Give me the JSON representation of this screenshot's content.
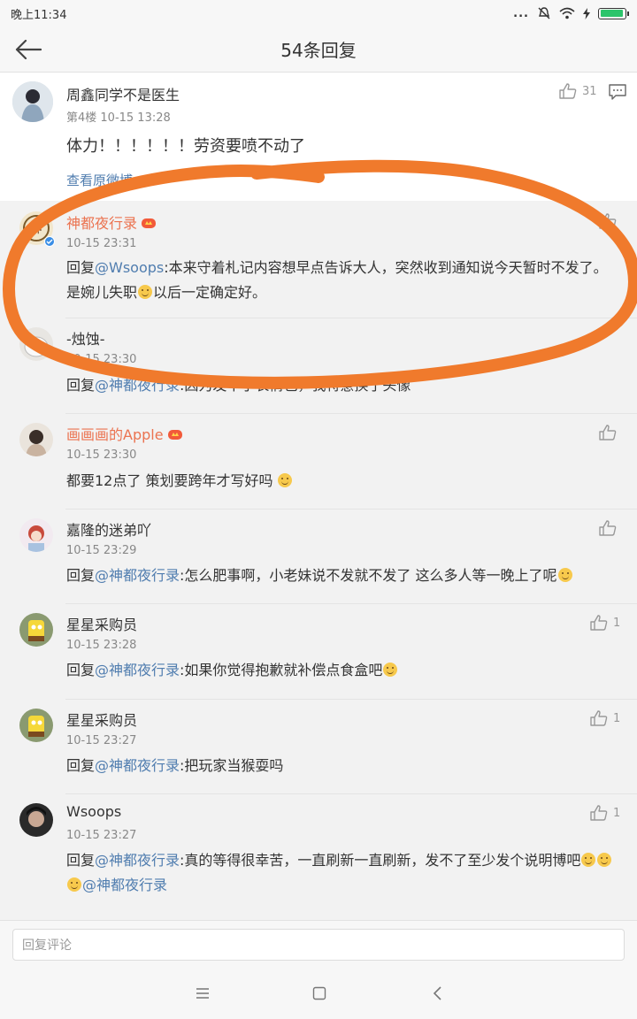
{
  "status_bar": {
    "time": "晚上11:34",
    "signal_text": "...",
    "battery_level": 0.95
  },
  "nav": {
    "title": "54条回复"
  },
  "main_post": {
    "username": "周鑫同学不是医生",
    "meta": "第4楼  10-15 13:28",
    "like_count": "31",
    "text": "体力！！！！！！劳资要喷不动了",
    "view_original": "查看原微博"
  },
  "replies": [
    {
      "username": "神都夜行录",
      "time": "10-15 23:31",
      "prefix": "回复",
      "mention": "@Wsoops",
      "text": ":本来守着札记内容想早点告诉大人，突然收到通知说今天暂时不发了。是婉儿失职",
      "text2": "以后一定确定好。",
      "like_count": ""
    },
    {
      "username": "-烛蚀-",
      "time": "10-15 23:30",
      "prefix": "回复",
      "mention": "@神都夜行录",
      "text": ":因为发不了表情包，我特意换了头像",
      "like_count": ""
    },
    {
      "username": "画画画的Apple",
      "time": "10-15 23:30",
      "text": "都要12点了 策划要跨年才写好吗",
      "like_count": ""
    },
    {
      "username": "嘉隆的迷弟吖",
      "time": "10-15 23:29",
      "prefix": "回复",
      "mention": "@神都夜行录",
      "text": ":怎么肥事啊，小老妹说不发就不发了 这么多人等一晚上了呢",
      "like_count": ""
    },
    {
      "username": "星星采购员",
      "time": "10-15 23:28",
      "prefix": "回复",
      "mention": "@神都夜行录",
      "text": ":如果你觉得抱歉就补偿点食盒吧",
      "like_count": "1"
    },
    {
      "username": "星星采购员",
      "time": "10-15 23:27",
      "prefix": "回复",
      "mention": "@神都夜行录",
      "text": ":把玩家当猴耍吗",
      "like_count": "1"
    },
    {
      "username": "Wsoops",
      "time": "10-15 23:27",
      "prefix": "回复",
      "mention": "@神都夜行录",
      "text": ":真的等得很幸苦，一直刷新一直刷新，发不了至少发个说明博吧",
      "mention2": "@神都夜行录",
      "like_count": "1"
    }
  ],
  "comment_bar": {
    "placeholder": "回复评论"
  },
  "colors": {
    "accent_orange": "#eb7350",
    "mention_blue": "#507daf",
    "annotation": "#f07a2c"
  },
  "icons": [
    "back-arrow-icon",
    "like-icon",
    "comment-icon",
    "mute-icon",
    "wifi-icon",
    "charging-icon",
    "vip-crown-icon",
    "verified-icon",
    "menu-icon",
    "home-icon",
    "back-nav-icon"
  ]
}
